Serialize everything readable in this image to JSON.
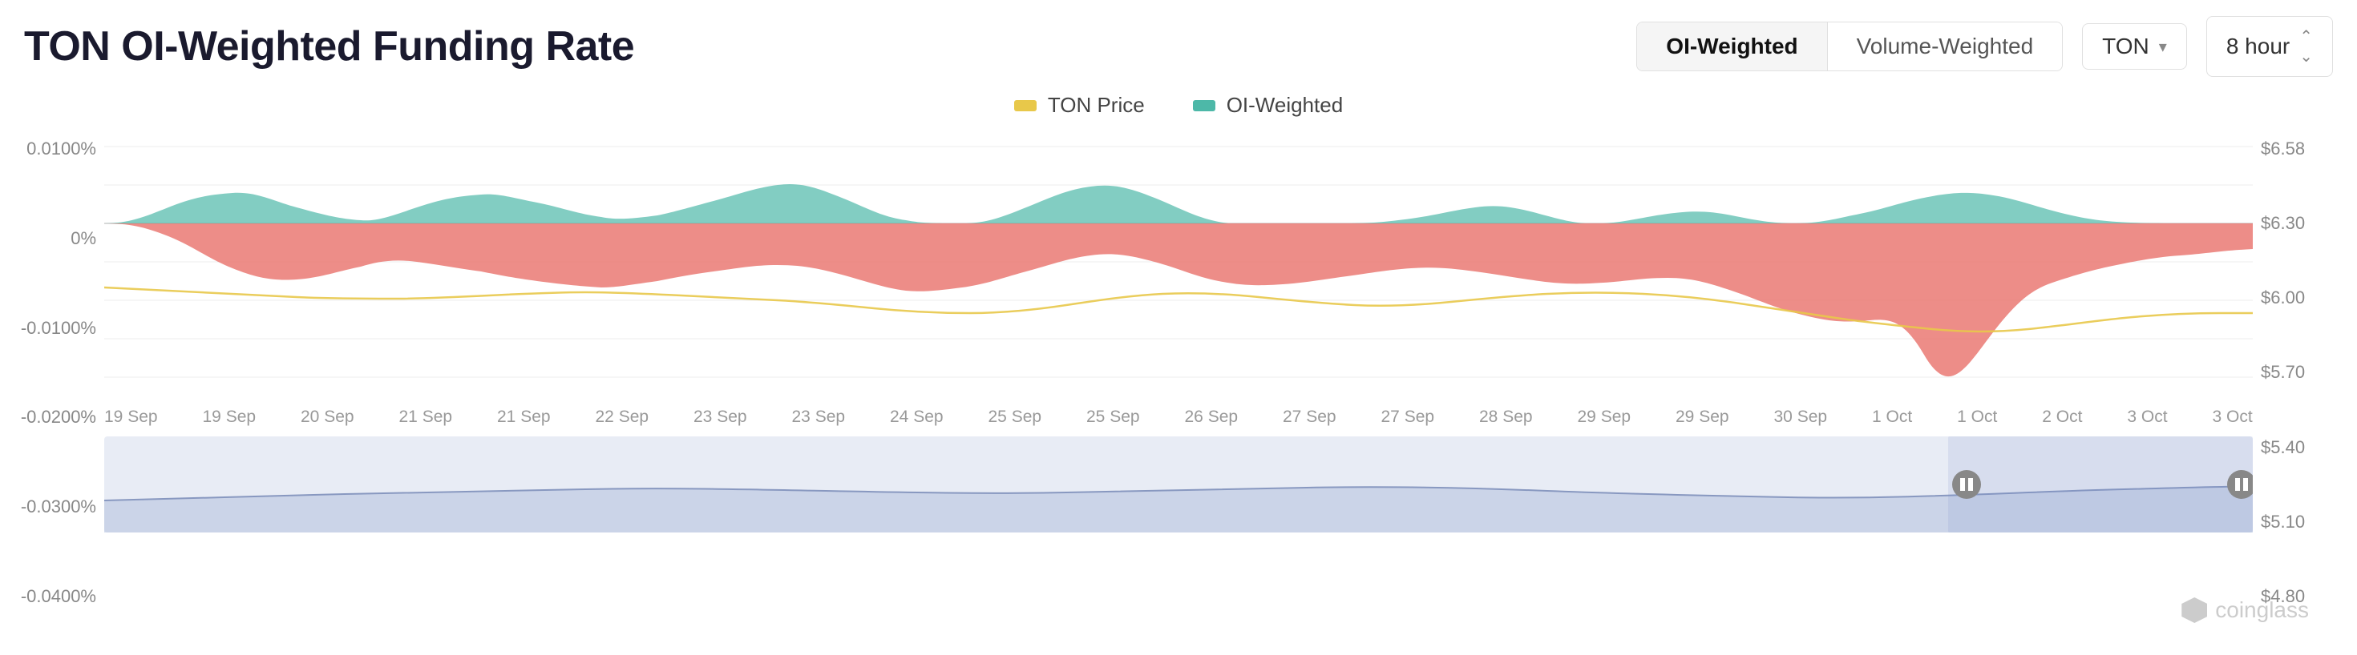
{
  "title": "TON OI-Weighted Funding Rate",
  "controls": {
    "toggle_options": [
      "OI-Weighted",
      "Volume-Weighted"
    ],
    "active_toggle": "OI-Weighted",
    "asset_label": "TON",
    "timeframe_label": "8 hour"
  },
  "legend": {
    "items": [
      {
        "label": "TON Price",
        "color": "#e8c84a",
        "key": "ton-price"
      },
      {
        "label": "OI-Weighted",
        "color": "#4db8a8",
        "key": "oi-weighted"
      }
    ]
  },
  "y_axis_left": {
    "labels": [
      "0.0100%",
      "0%",
      "-0.0100%",
      "-0.0200%",
      "-0.0300%",
      "-0.0400%"
    ]
  },
  "y_axis_right": {
    "labels": [
      "$6.58",
      "$6.30",
      "$6.00",
      "$5.70",
      "$5.40",
      "$5.10",
      "$4.80"
    ]
  },
  "x_axis": {
    "labels": [
      "19 Sep",
      "19 Sep",
      "20 Sep",
      "21 Sep",
      "21 Sep",
      "22 Sep",
      "23 Sep",
      "23 Sep",
      "24 Sep",
      "25 Sep",
      "25 Sep",
      "26 Sep",
      "27 Sep",
      "27 Sep",
      "28 Sep",
      "29 Sep",
      "29 Sep",
      "30 Sep",
      "1 Oct",
      "1 Oct",
      "2 Oct",
      "3 Oct",
      "3 Oct"
    ]
  },
  "watermark": {
    "logo_alt": "coinglass-logo",
    "text": "coinglass"
  }
}
